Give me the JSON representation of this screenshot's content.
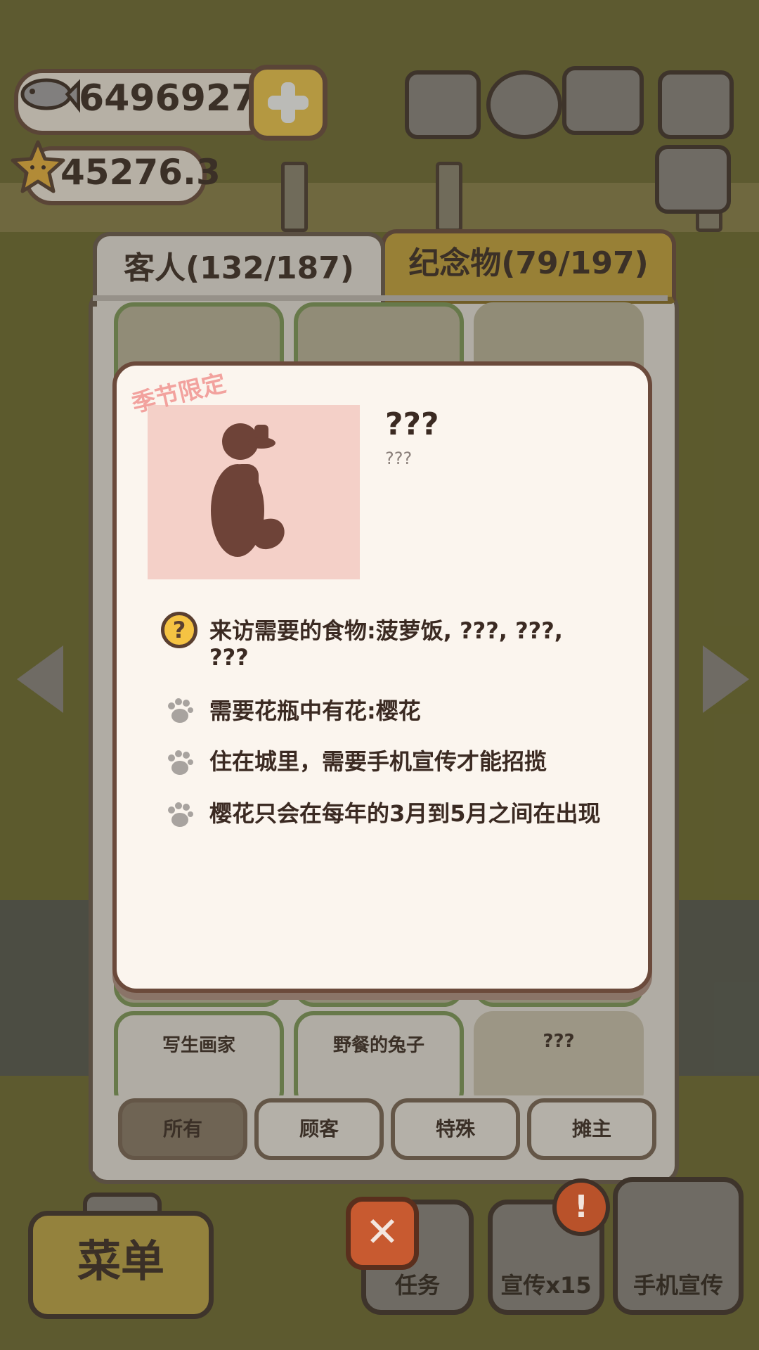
{
  "currency": {
    "fish_value": "6496927",
    "star_value": "45276.3"
  },
  "tabs": {
    "guests": "客人(132/187)",
    "souvenirs": "纪念物(79/197)"
  },
  "grid": {
    "bottom_cards": [
      "写生画家",
      "野餐的兔子",
      "???"
    ]
  },
  "filters": [
    "所有",
    "顾客",
    "特殊",
    "摊主"
  ],
  "popup": {
    "season_tag": "季节限定",
    "name": "???",
    "subtitle": "???",
    "requirements": [
      "来访需要的食物:菠萝饭, ???, ???, ???",
      "需要花瓶中有花:樱花",
      "住在城里，需要手机宣传才能招揽",
      "樱花只会在每年的3月到5月之间在出现"
    ]
  },
  "bottom_bar": {
    "menu": "菜单",
    "tasks": "任务",
    "promo": "宣传x15",
    "phone_promo": "手机宣传",
    "alert": "!",
    "close": "✕"
  },
  "icons": [
    "fish-icon",
    "plus-icon",
    "star-icon",
    "ranking-icon",
    "gear-icon",
    "book-icon",
    "camera-icon",
    "newspaper-icon",
    "question-icon",
    "paw-icon",
    "close-icon",
    "arrow-left-icon",
    "arrow-right-icon"
  ]
}
